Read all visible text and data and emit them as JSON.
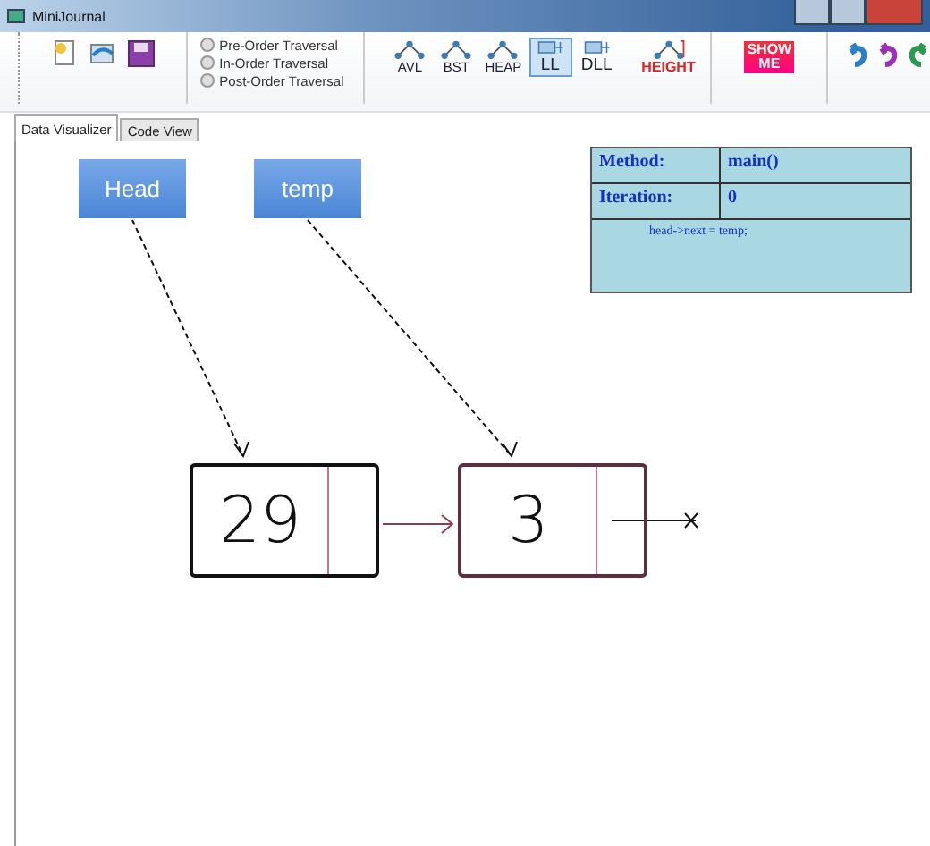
{
  "window": {
    "title": "MiniJournal"
  },
  "file_tools": [
    {
      "kind": "new"
    },
    {
      "kind": "open"
    },
    {
      "kind": "save"
    }
  ],
  "traversals": [
    {
      "label": "Pre-Order Traversal",
      "selected": false
    },
    {
      "label": "In-Order Traversal",
      "selected": false
    },
    {
      "label": "Post-Order Traversal",
      "selected": false
    }
  ],
  "structures": [
    {
      "label": "AVL",
      "kind": "tree",
      "selected": false
    },
    {
      "label": "BST",
      "kind": "tree",
      "selected": false
    },
    {
      "label": "HEAP",
      "kind": "tree",
      "selected": false
    },
    {
      "label": "LL",
      "kind": "list",
      "selected": true
    },
    {
      "label": "DLL",
      "kind": "list",
      "selected": false
    },
    {
      "label": "HEIGHT",
      "kind": "height",
      "selected": false
    }
  ],
  "show_me": {
    "label": "SHOW ME"
  },
  "history_tools": [
    {
      "kind": "undo",
      "color": "#2a7fc8"
    },
    {
      "kind": "undo",
      "color": "#9b2fb5"
    },
    {
      "kind": "redo",
      "color": "#2a9a50"
    }
  ],
  "tabs": [
    {
      "label": "Data Visualizer",
      "selected": true
    },
    {
      "label": "Code View",
      "selected": false
    }
  ],
  "pointers": [
    {
      "label": "Head"
    },
    {
      "label": "temp"
    }
  ],
  "nodes": [
    {
      "value": "29"
    },
    {
      "value": "3"
    }
  ],
  "info": {
    "method_label": "Method:",
    "method": "main()",
    "iteration_label": "Iteration:",
    "iteration": "0",
    "code": "head->next = temp;"
  }
}
